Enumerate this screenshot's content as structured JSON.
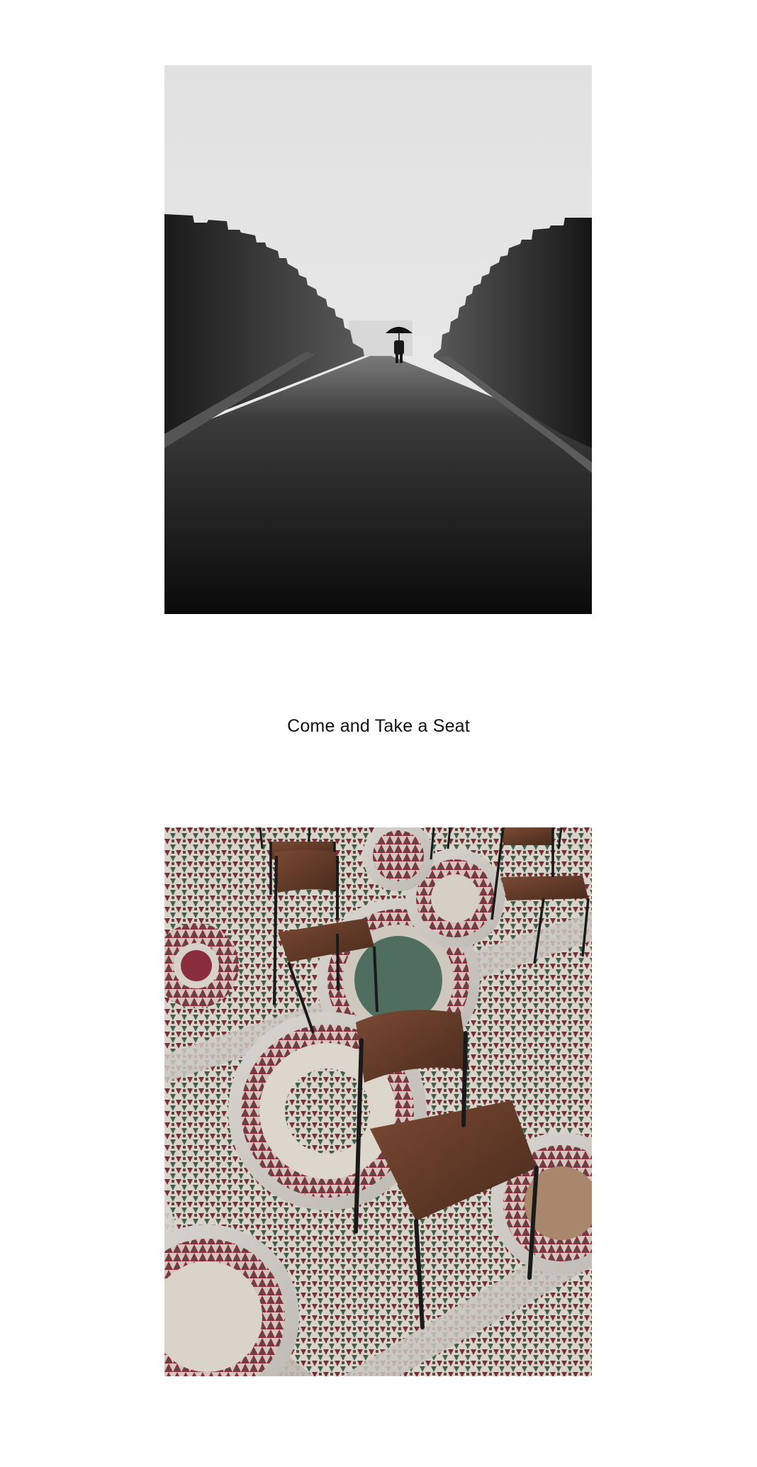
{
  "gallery": {
    "caption": "Come and Take a Seat",
    "photos": [
      {
        "subject": "fog-bridge-umbrella-photo"
      },
      {
        "subject": "mosaic-floor-chairs-photo"
      }
    ]
  },
  "colors": {
    "background": "#ffffff",
    "caption_text": "#111111"
  }
}
